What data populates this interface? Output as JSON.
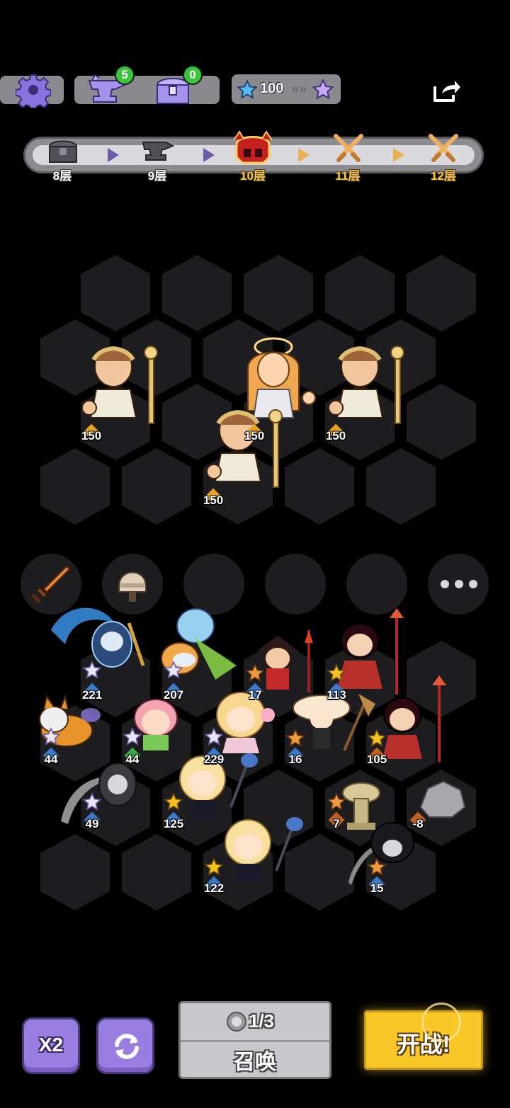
{
  "top_bar": {
    "settings_icon": "gear-icon",
    "anvil_count": "5",
    "chest_count": "0",
    "star_value": "100",
    "share_icon": "share-icon"
  },
  "floor_progress": {
    "floors": [
      {
        "label": "8层",
        "icon": "chest-icon",
        "state": "passed"
      },
      {
        "label": "9层",
        "icon": "anvil-icon",
        "state": "passed"
      },
      {
        "label": "10层",
        "icon": "boss-helmet-icon",
        "state": "current"
      },
      {
        "label": "11层",
        "icon": "crossed-swords-icon",
        "state": "upcoming"
      },
      {
        "label": "12层",
        "icon": "crossed-swords-icon",
        "state": "upcoming"
      }
    ]
  },
  "enemies": [
    {
      "name": "laurel-soldier",
      "level": "150"
    },
    {
      "name": "goddess",
      "level": "150"
    },
    {
      "name": "laurel-soldier",
      "level": "150"
    },
    {
      "name": "laurel-soldier",
      "level": "150"
    }
  ],
  "equipment_slots": [
    {
      "item": "sword-icon"
    },
    {
      "item": "helmet-icon"
    },
    {
      "item": ""
    },
    {
      "item": ""
    },
    {
      "item": ""
    },
    {
      "item": "more-icon"
    }
  ],
  "units": [
    {
      "name": "scythe-reaper-blue",
      "level": "221",
      "star": "white"
    },
    {
      "name": "ice-fairy",
      "level": "207",
      "star": "white"
    },
    {
      "name": "red-warrior-hat",
      "level": "17",
      "star": "orange"
    },
    {
      "name": "red-spear-girl",
      "level": "113",
      "star": "gold"
    },
    {
      "name": "corgi",
      "level": "44",
      "star": "white"
    },
    {
      "name": "pink-hair-girl",
      "level": "44",
      "star": "white"
    },
    {
      "name": "blonde-fairy",
      "level": "229",
      "star": "white"
    },
    {
      "name": "mushroom-hat-broom",
      "level": "16",
      "star": "orange"
    },
    {
      "name": "red-spear-girl-2",
      "level": "105",
      "star": "gold"
    },
    {
      "name": "grey-reaper",
      "level": "49",
      "star": "white"
    },
    {
      "name": "maid",
      "level": "125",
      "star": "gold"
    },
    {
      "name": "mushroom-statue",
      "level": "7",
      "star": "orange"
    },
    {
      "name": "rock",
      "level": "-8",
      "star": ""
    },
    {
      "name": "maid-2",
      "level": "122",
      "star": "gold"
    },
    {
      "name": "dark-reaper",
      "level": "15",
      "star": "orange"
    }
  ],
  "bottom": {
    "speed_label": "X2",
    "refresh_icon": "refresh-icon",
    "summon_count": "1/3",
    "summon_label": "召唤",
    "fight_label": "开战!"
  },
  "colors": {
    "star_blue": "#58b8f0",
    "star_purple": "#c8a8f8",
    "gold": "#f4c020",
    "accent_purple": "#9a7de0"
  }
}
